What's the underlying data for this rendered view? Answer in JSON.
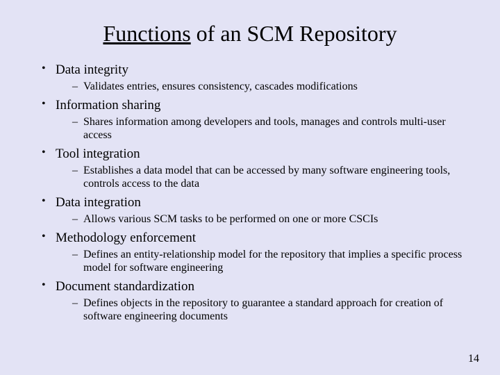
{
  "title_underlined": "Functions",
  "title_rest": " of an SCM Repository",
  "items": [
    {
      "heading": "Data integrity",
      "detail": "Validates entries, ensures consistency, cascades modifications"
    },
    {
      "heading": "Information sharing",
      "detail": "Shares information among developers and tools, manages and controls multi-user access"
    },
    {
      "heading": "Tool integration",
      "detail": "Establishes a data model that can be accessed by many software engineering tools, controls access to the data"
    },
    {
      "heading": "Data integration",
      "detail": "Allows various SCM tasks to be performed on one or more CSCIs"
    },
    {
      "heading": "Methodology enforcement",
      "detail": "Defines an entity-relationship model for the repository that implies a specific process model for software engineering"
    },
    {
      "heading": "Document standardization",
      "detail": "Defines objects in the repository to guarantee a standard approach for creation of software engineering documents"
    }
  ],
  "page_number": "14"
}
